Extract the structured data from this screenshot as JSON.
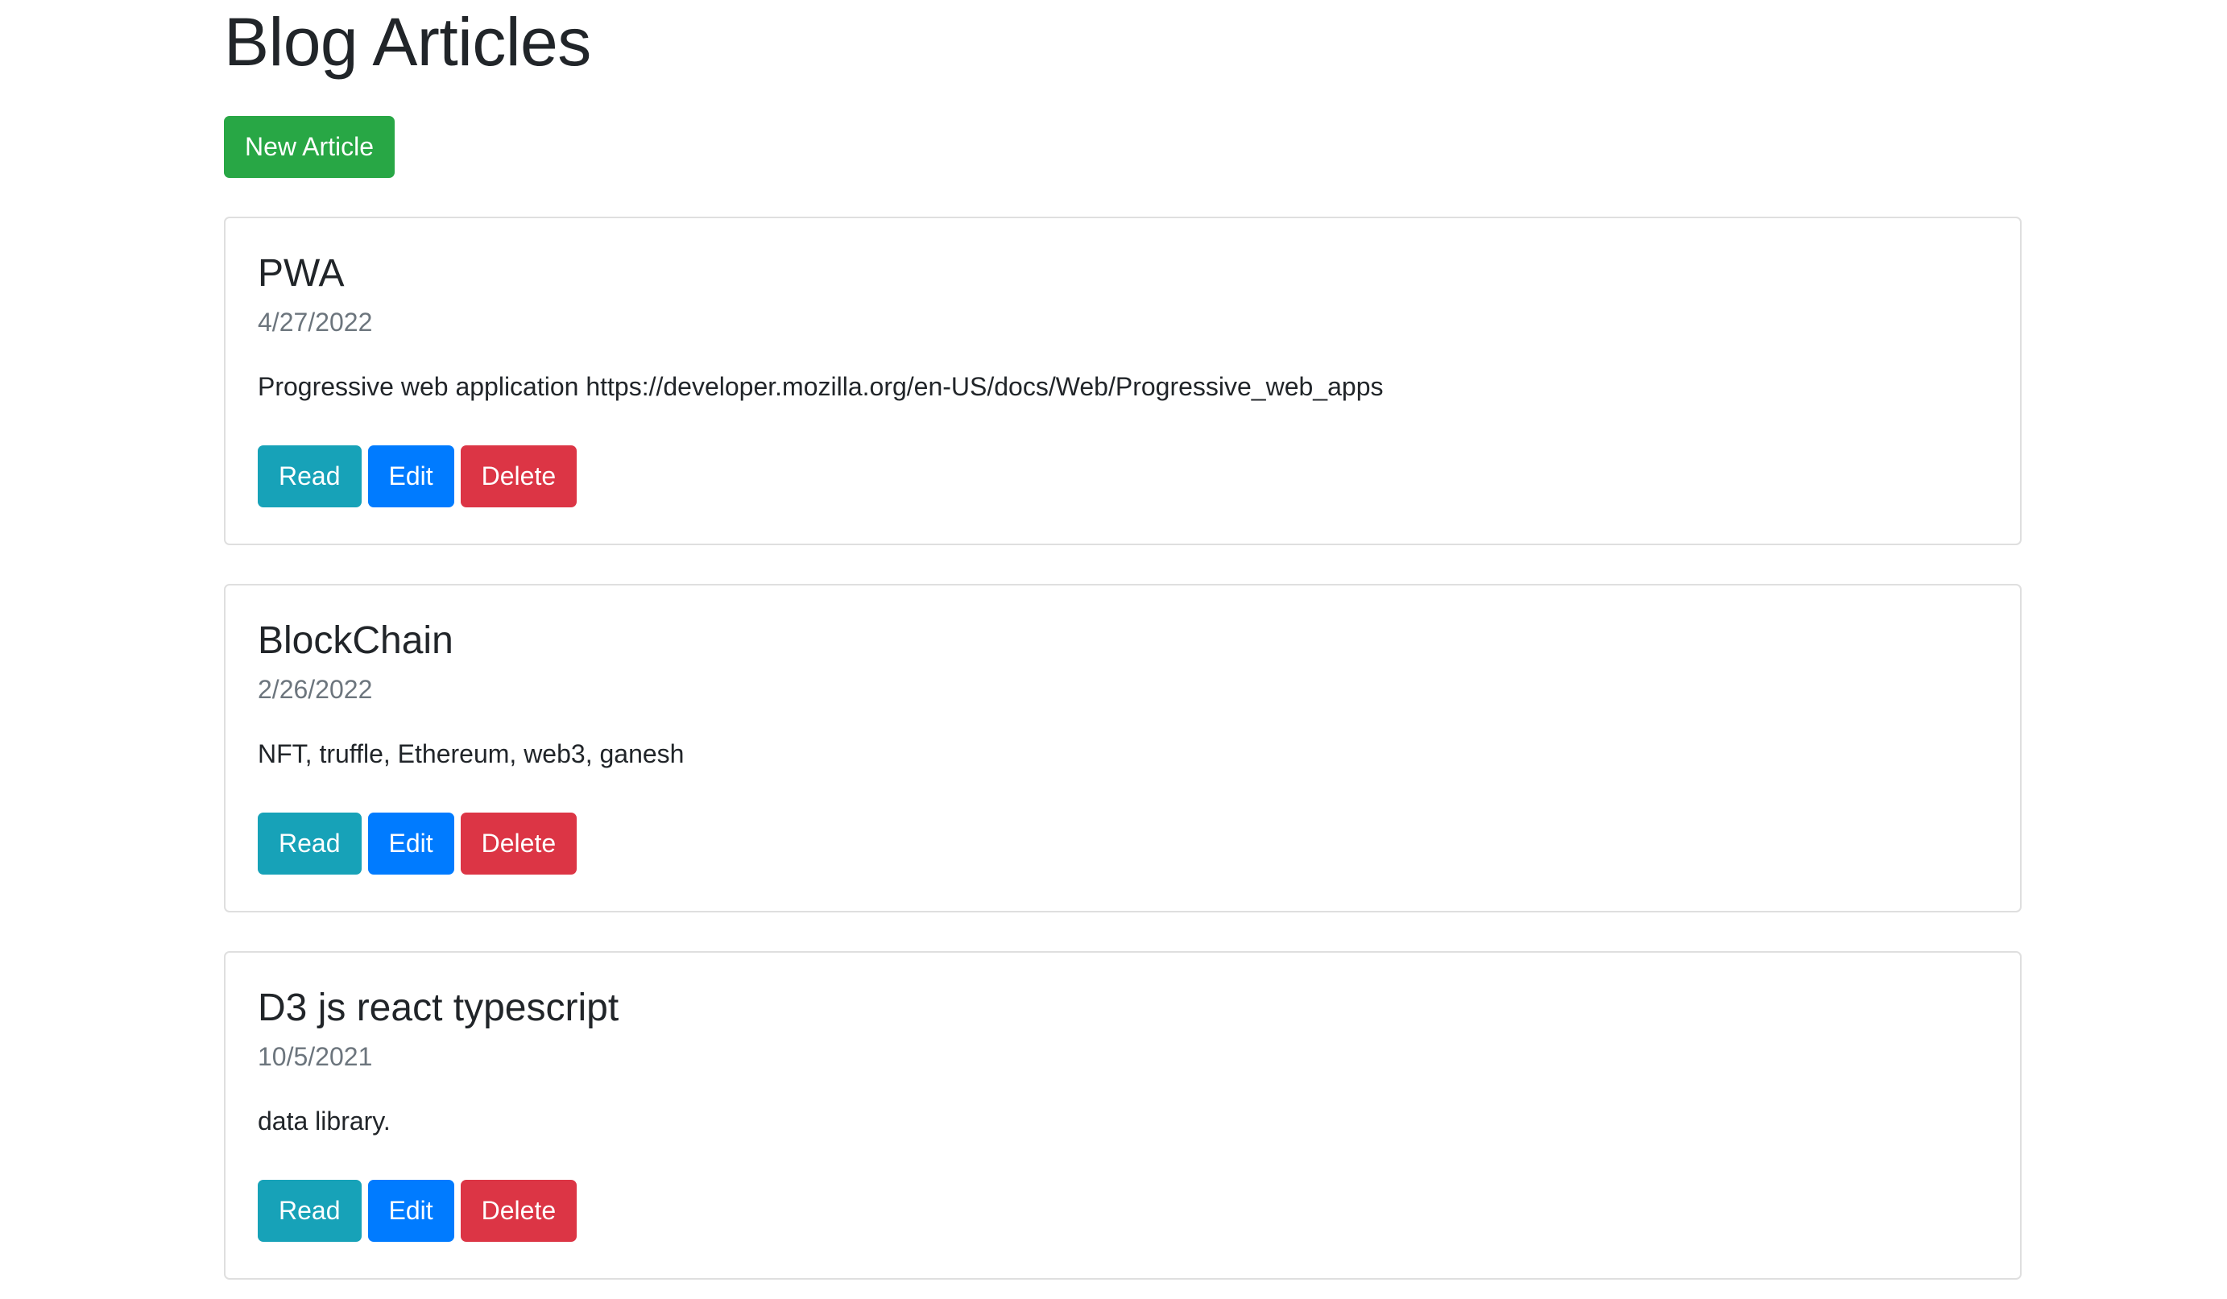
{
  "page": {
    "title": "Blog Articles",
    "new_article_label": "New Article"
  },
  "articles": [
    {
      "title": "PWA",
      "date": "4/27/2022",
      "description": "Progressive web application https://developer.mozilla.org/en-US/docs/Web/Progressive_web_apps",
      "read_label": "Read",
      "edit_label": "Edit",
      "delete_label": "Delete"
    },
    {
      "title": "BlockChain",
      "date": "2/26/2022",
      "description": "NFT, truffle, Ethereum, web3, ganesh",
      "read_label": "Read",
      "edit_label": "Edit",
      "delete_label": "Delete"
    },
    {
      "title": "D3 js react typescript",
      "date": "10/5/2021",
      "description": "data library.",
      "read_label": "Read",
      "edit_label": "Edit",
      "delete_label": "Delete"
    }
  ],
  "colors": {
    "new_article": "#28a745",
    "read": "#17a2b8",
    "edit": "#007bff",
    "delete": "#dc3545",
    "muted_text": "#6c757d"
  }
}
